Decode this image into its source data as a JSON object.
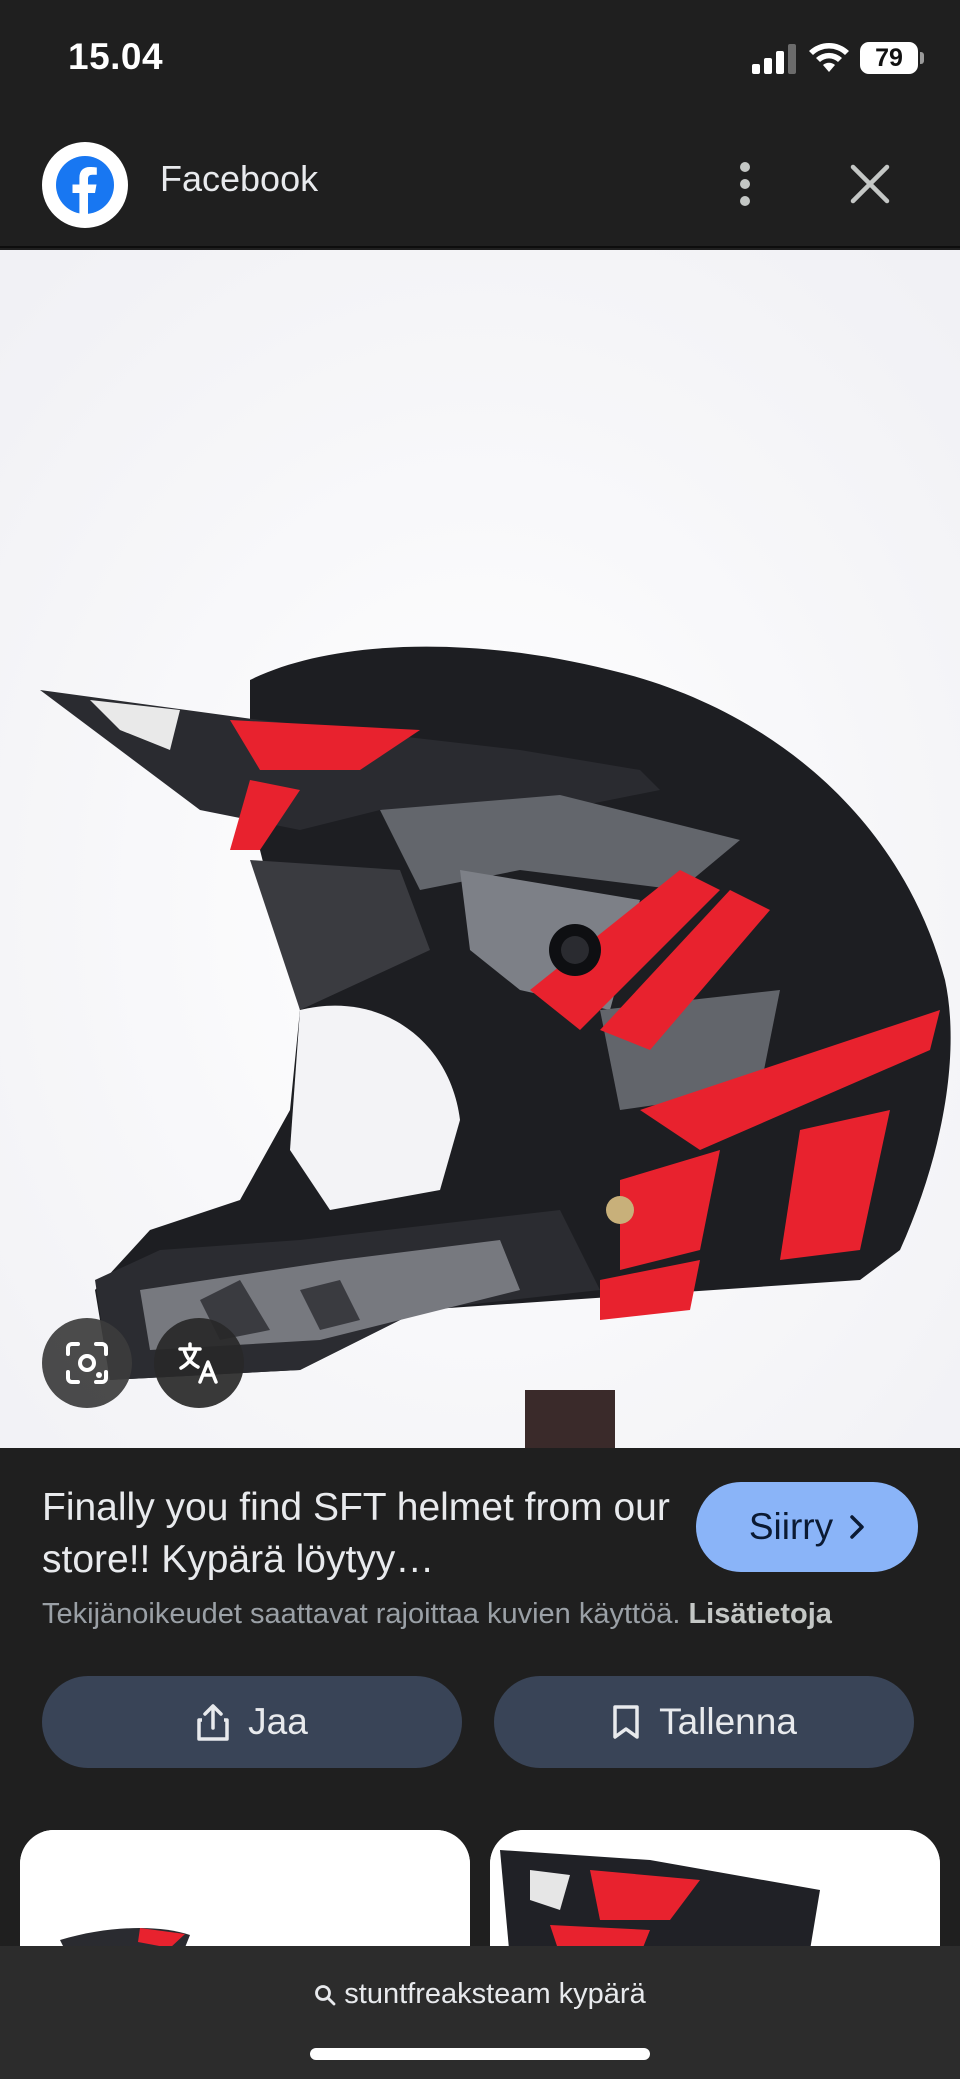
{
  "status_bar": {
    "time": "15.04",
    "battery": "79"
  },
  "header": {
    "app_name": "Facebook",
    "more_icon": "more-vert-icon",
    "close_icon": "close-icon"
  },
  "image_overlay": {
    "lens_icon": "lens-icon",
    "translate_icon": "translate-icon"
  },
  "info": {
    "title": "Finally you find SFT helmet from our store!! Kypärä löytyy…",
    "go_label": "Siirry",
    "copyright_text": "Tekijänoikeudet saattavat rajoittaa kuvien käyttöä.",
    "more_info_link": "Lisätietoja",
    "share_label": "Jaa",
    "save_label": "Tallenna"
  },
  "bottom_search": {
    "query": "stuntfreaksteam kypärä"
  },
  "colors": {
    "accent": "#8ab4f8",
    "action_bg": "#394457",
    "background": "#1f1f1f",
    "facebook_blue": "#1877f2"
  }
}
